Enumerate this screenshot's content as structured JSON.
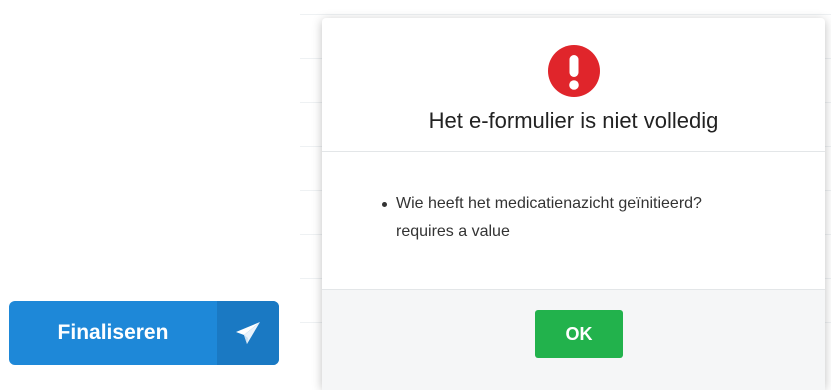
{
  "finalize_button": {
    "label": "Finaliseren",
    "icon": "paper-plane-icon"
  },
  "dialog": {
    "icon": "exclamation-circle-icon",
    "title": "Het e-formulier is niet volledig",
    "messages": [
      {
        "line1": "Wie heeft het medicatienazicht geïnitieerd?",
        "line2": "requires a value"
      }
    ],
    "ok_label": "OK"
  },
  "colors": {
    "primary": "#1e88d8",
    "primary_dark": "#1a79c3",
    "success": "#22b24c",
    "danger": "#e0252b"
  }
}
